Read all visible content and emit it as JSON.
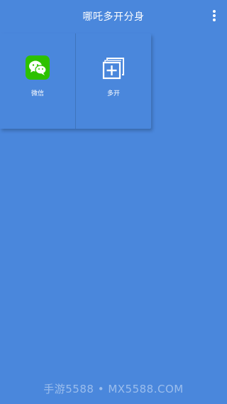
{
  "app_bar": {
    "title": "哪吒多开分身",
    "menu_icon": "more-vertical-icon"
  },
  "apps": [
    {
      "label": "微信",
      "icon": "wechat-icon"
    },
    {
      "label": "多开",
      "icon": "add-clone-icon"
    }
  ],
  "watermark": "手游5588 • MX5588.COM",
  "colors": {
    "background": "#4a87dc",
    "wechat_green": "#2dc100",
    "text": "#ffffff"
  }
}
